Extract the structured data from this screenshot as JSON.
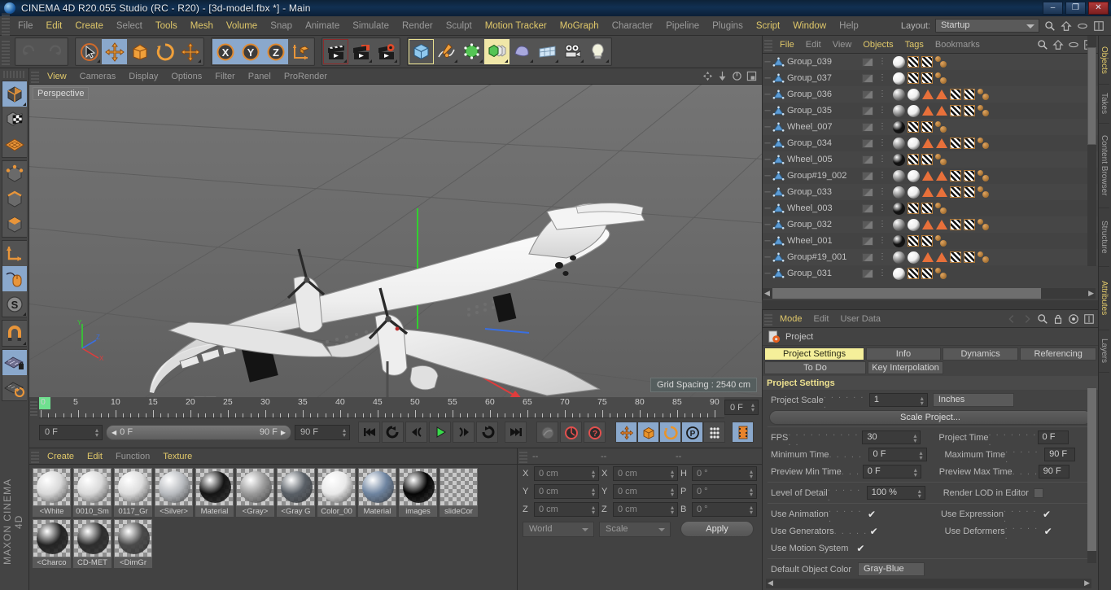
{
  "window": {
    "title": "CINEMA 4D R20.055 Studio (RC - R20) - [3d-model.fbx *] - Main",
    "minimize": "–",
    "maximize": "❐",
    "close": "✕"
  },
  "menubar": {
    "items": [
      {
        "label": "File",
        "enabled": false
      },
      {
        "label": "Edit",
        "enabled": true
      },
      {
        "label": "Create",
        "enabled": true
      },
      {
        "label": "Select",
        "enabled": false
      },
      {
        "label": "Tools",
        "enabled": true
      },
      {
        "label": "Mesh",
        "enabled": true
      },
      {
        "label": "Volume",
        "enabled": true
      },
      {
        "label": "Snap",
        "enabled": false
      },
      {
        "label": "Animate",
        "enabled": false
      },
      {
        "label": "Simulate",
        "enabled": false
      },
      {
        "label": "Render",
        "enabled": false
      },
      {
        "label": "Sculpt",
        "enabled": false
      },
      {
        "label": "Motion Tracker",
        "enabled": true
      },
      {
        "label": "MoGraph",
        "enabled": true
      },
      {
        "label": "Character",
        "enabled": false
      },
      {
        "label": "Pipeline",
        "enabled": false
      },
      {
        "label": "Plugins",
        "enabled": false
      },
      {
        "label": "Script",
        "enabled": true
      },
      {
        "label": "Window",
        "enabled": true
      },
      {
        "label": "Help",
        "enabled": false
      }
    ],
    "layout_label": "Layout:",
    "layout_value": "Startup"
  },
  "viewport": {
    "menu": [
      "View",
      "Cameras",
      "Display",
      "Options",
      "Filter",
      "Panel",
      "ProRender"
    ],
    "label": "Perspective",
    "grid_spacing": "Grid Spacing : 2540 cm",
    "axis": {
      "x": "X",
      "y": "Y",
      "z": "Z"
    }
  },
  "timeline": {
    "ticks": [
      "0",
      "5",
      "10",
      "15",
      "20",
      "25",
      "30",
      "35",
      "40",
      "45",
      "50",
      "55",
      "60",
      "65",
      "70",
      "75",
      "80",
      "85",
      "90"
    ],
    "current_frame": "0 F",
    "range_start": "0 F",
    "range_end": "90 F",
    "end_frame": "90 F",
    "right_frame": "0 F",
    "transport": [
      "go-to-start",
      "play-back-loop",
      "step-back",
      "play",
      "step-forward",
      "loop",
      "go-to-end"
    ],
    "record_tools": [
      "autokey",
      "record-active-objects",
      "record-help"
    ],
    "key_toggles": [
      "position",
      "scale",
      "rotation",
      "param",
      "point-level"
    ]
  },
  "materials": {
    "menu": [
      "Create",
      "Edit",
      "Function",
      "Texture"
    ],
    "items": [
      {
        "name": "<White",
        "color": "#d8d8d8"
      },
      {
        "name": "0010_Sm",
        "color": "#d9d9d9"
      },
      {
        "name": "0117_Gr",
        "color": "#dcdcdc"
      },
      {
        "name": "<Silver>",
        "color": "#b9bcc0"
      },
      {
        "name": "Material",
        "color": "#141414"
      },
      {
        "name": "<Gray>",
        "color": "#9a9a9a"
      },
      {
        "name": "<Gray G",
        "color": "#595f66"
      },
      {
        "name": "Color_00",
        "color": "#e9e9e9"
      },
      {
        "name": "Material",
        "color": "#6e84a0"
      },
      {
        "name": "images",
        "color": "#050505"
      },
      {
        "name": "slideCor",
        "color": "transparent"
      },
      {
        "name": "<Charco",
        "color": "#232323"
      },
      {
        "name": "CD-MET",
        "color": "#2d2d2d"
      },
      {
        "name": "<DimGr",
        "color": "#4a4a4a"
      }
    ]
  },
  "coordinates": {
    "headers": [
      "--",
      "--",
      "--"
    ],
    "rows": [
      {
        "label1": "X",
        "v1": "0 cm",
        "label2": "X",
        "v2": "0 cm",
        "label3": "H",
        "v3": "0 °"
      },
      {
        "label1": "Y",
        "v1": "0 cm",
        "label2": "Y",
        "v2": "0 cm",
        "label3": "P",
        "v3": "0 °"
      },
      {
        "label1": "Z",
        "v1": "0 cm",
        "label2": "Z",
        "v2": "0 cm",
        "label3": "B",
        "v3": "0 °"
      }
    ],
    "system": "World",
    "mode": "Scale",
    "apply": "Apply"
  },
  "objects": {
    "menu": [
      "File",
      "Edit",
      "View",
      "Objects",
      "Tags",
      "Bookmarks"
    ],
    "rows": [
      {
        "name": "Group_039",
        "tags": [
          "ball-white",
          "check",
          "check",
          "dots"
        ]
      },
      {
        "name": "Group_037",
        "tags": [
          "ball-white",
          "check",
          "check",
          "dots"
        ]
      },
      {
        "name": "Group_036",
        "tags": [
          "ball-gray",
          "ball-white",
          "tri",
          "tri",
          "check",
          "check",
          "dots"
        ]
      },
      {
        "name": "Group_035",
        "tags": [
          "ball-gray",
          "ball-white",
          "tri",
          "tri",
          "check",
          "check",
          "dots"
        ]
      },
      {
        "name": "Wheel_007",
        "tags": [
          "ball-black",
          "check",
          "check",
          "dots"
        ]
      },
      {
        "name": "Group_034",
        "tags": [
          "ball-gray",
          "ball-white",
          "tri",
          "tri",
          "check",
          "check",
          "dots"
        ]
      },
      {
        "name": "Wheel_005",
        "tags": [
          "ball-black",
          "check",
          "check",
          "dots"
        ]
      },
      {
        "name": "Group#19_002",
        "tags": [
          "ball-gray",
          "ball-white",
          "tri",
          "tri",
          "check",
          "check",
          "dots"
        ]
      },
      {
        "name": "Group_033",
        "tags": [
          "ball-gray",
          "ball-white",
          "tri",
          "tri",
          "check",
          "check",
          "dots"
        ]
      },
      {
        "name": "Wheel_003",
        "tags": [
          "ball-black",
          "check",
          "check",
          "dots"
        ]
      },
      {
        "name": "Group_032",
        "tags": [
          "ball-gray",
          "ball-white",
          "tri",
          "tri",
          "check",
          "check",
          "dots"
        ]
      },
      {
        "name": "Wheel_001",
        "tags": [
          "ball-black",
          "check",
          "check",
          "dots"
        ]
      },
      {
        "name": "Group#19_001",
        "tags": [
          "ball-gray",
          "ball-white",
          "tri",
          "tri",
          "check",
          "check",
          "dots"
        ]
      },
      {
        "name": "Group_031",
        "tags": [
          "ball-white",
          "check",
          "check",
          "dots"
        ]
      }
    ]
  },
  "attributes": {
    "menu": [
      "Mode",
      "Edit",
      "User Data"
    ],
    "object_title": "Project",
    "tabs_row1": [
      "Project Settings",
      "Info",
      "Dynamics",
      "Referencing"
    ],
    "tabs_row2": [
      "To Do",
      "Key Interpolation"
    ],
    "active_tab": "Project Settings",
    "section_title": "Project Settings",
    "project_scale_label": "Project Scale",
    "project_scale_value": "1",
    "project_scale_unit": "Inches",
    "scale_project_button": "Scale Project...",
    "fps_label": "FPS",
    "fps_value": "30",
    "project_time_label": "Project Time",
    "project_time_value": "0 F",
    "minimum_time_label": "Minimum Time",
    "minimum_time_value": "0 F",
    "maximum_time_label": "Maximum Time",
    "maximum_time_value": "90 F",
    "preview_min_label": "Preview Min Time",
    "preview_min_value": "0 F",
    "preview_max_label": "Preview Max Time",
    "preview_max_value": "90 F",
    "lod_label": "Level of Detail",
    "lod_value": "100 %",
    "render_lod_label": "Render LOD in Editor",
    "use_animation_label": "Use Animation",
    "use_expression_label": "Use Expression",
    "use_generators_label": "Use Generators",
    "use_deformers_label": "Use Deformers",
    "use_motion_label": "Use Motion System",
    "default_color_label": "Default Object Color",
    "default_color_value": "Gray-Blue",
    "check_glyph": "✔"
  },
  "right_dock": {
    "tabs": [
      "Objects",
      "Takes",
      "Content Browser",
      "Structure",
      "Attributes",
      "Layers"
    ],
    "active": "Objects"
  },
  "branding": {
    "maxon": "MAXON",
    "c4d": "CINEMA 4D"
  },
  "colors": {
    "accent_yellow": "#e0c86a",
    "selection_blue": "#8aa8cc",
    "orange": "#e8832a",
    "panel_bg": "#434343",
    "viewport_bg": "#6b6b6b"
  }
}
